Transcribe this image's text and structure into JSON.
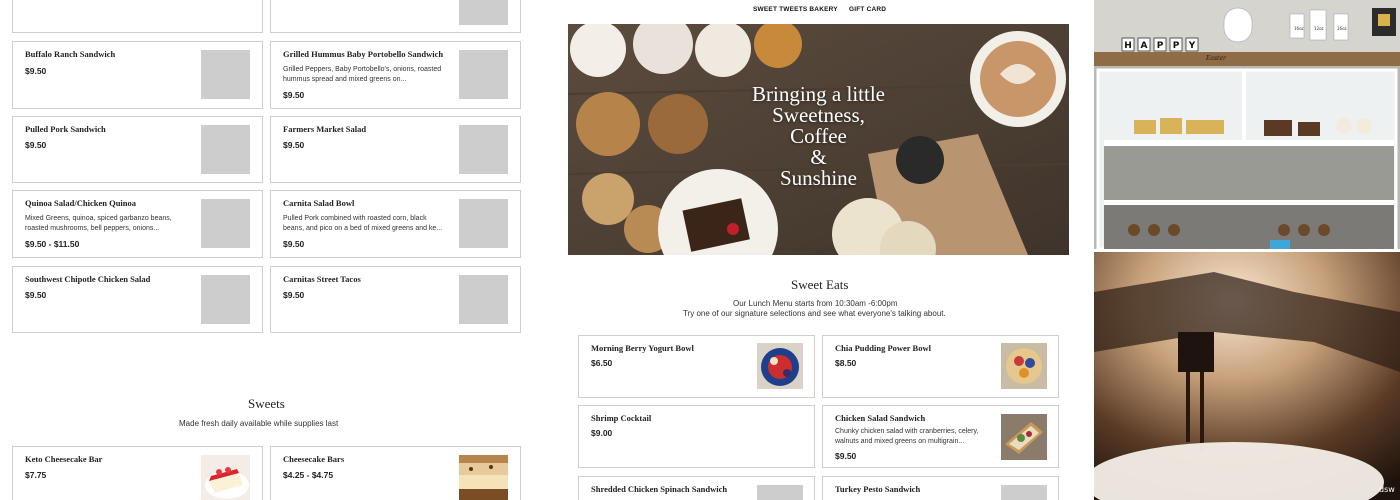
{
  "nav": {
    "bakery_link": "SWEET TWEETS BAKERY",
    "gift_card_link": "GIFT CARD"
  },
  "hero": {
    "line1": "Bringing a little",
    "line2": "Sweetness,",
    "line3": "Coffee",
    "line4": "&",
    "line5": "Sunshine"
  },
  "menu_left": {
    "buffalo": {
      "name": "Buffalo Ranch Sandwich",
      "price": "$9.50"
    },
    "hummus": {
      "name": "Grilled Hummus Baby Portobello Sandwich",
      "desc": "Grilled Peppers, Baby Portobello's, onions, roasted hummus spread and mixed greens on...",
      "price": "$9.50"
    },
    "pork": {
      "name": "Pulled Pork Sandwich",
      "price": "$9.50"
    },
    "farmers": {
      "name": "Farmers Market Salad",
      "price": "$9.50"
    },
    "quinoa": {
      "name": "Quinoa Salad/Chicken Quinoa",
      "desc": "Mixed Greens, quinoa, spiced garbanzo beans, roasted mushrooms, bell peppers, onions...",
      "price": "$9.50 - $11.50"
    },
    "carnita": {
      "name": "Carnita Salad Bowl",
      "desc": "Pulled Pork combined with roasted corn, black beans, and pico on a bed of mixed greens and ke...",
      "price": "$9.50"
    },
    "chipotle": {
      "name": "Southwest Chipotle Chicken Salad",
      "price": "$9.50"
    },
    "tacos": {
      "name": "Carnitas Street Tacos",
      "price": "$9.50"
    }
  },
  "sweets": {
    "title": "Sweets",
    "subtitle": "Made fresh daily available while supplies last",
    "keto": {
      "name": "Keto Cheesecake Bar",
      "price": "$7.75"
    },
    "cheesecake": {
      "name": "Cheesecake Bars",
      "price": "$4.25 - $4.75"
    }
  },
  "eats": {
    "title": "Sweet Eats",
    "line1": "Our Lunch Menu starts from 10:30am -6:00pm",
    "line2": "Try one of our signature selections and see what everyone's talking about.",
    "yogurt": {
      "name": "Morning Berry Yogurt Bowl",
      "price": "$6.50"
    },
    "chia": {
      "name": "Chia Pudding Power Bowl",
      "price": "$8.50"
    },
    "shrimp": {
      "name": "Shrimp Cocktail",
      "price": "$9.00"
    },
    "chicken_salad": {
      "name": "Chicken Salad Sandwich",
      "desc": "Chunky chicken salad with cranberries, celery, walnuts and mixed greens on multigrain...",
      "price": "$9.50"
    },
    "spinach": {
      "name": "Shredded Chicken Spinach Sandwich"
    },
    "pesto": {
      "name": "Turkey Pesto Sandwich"
    }
  },
  "side": {
    "sign_letters": [
      "H",
      "A",
      "P",
      "P",
      "Y"
    ],
    "sign_word": "Easter",
    "cup_numbers": [
      "16oz",
      "12oz",
      "16oz"
    ],
    "watermark": "dsw"
  },
  "colors": {
    "card_border": "#cfcfcf",
    "placeholder": "#cdcdcd",
    "text": "#222222"
  }
}
